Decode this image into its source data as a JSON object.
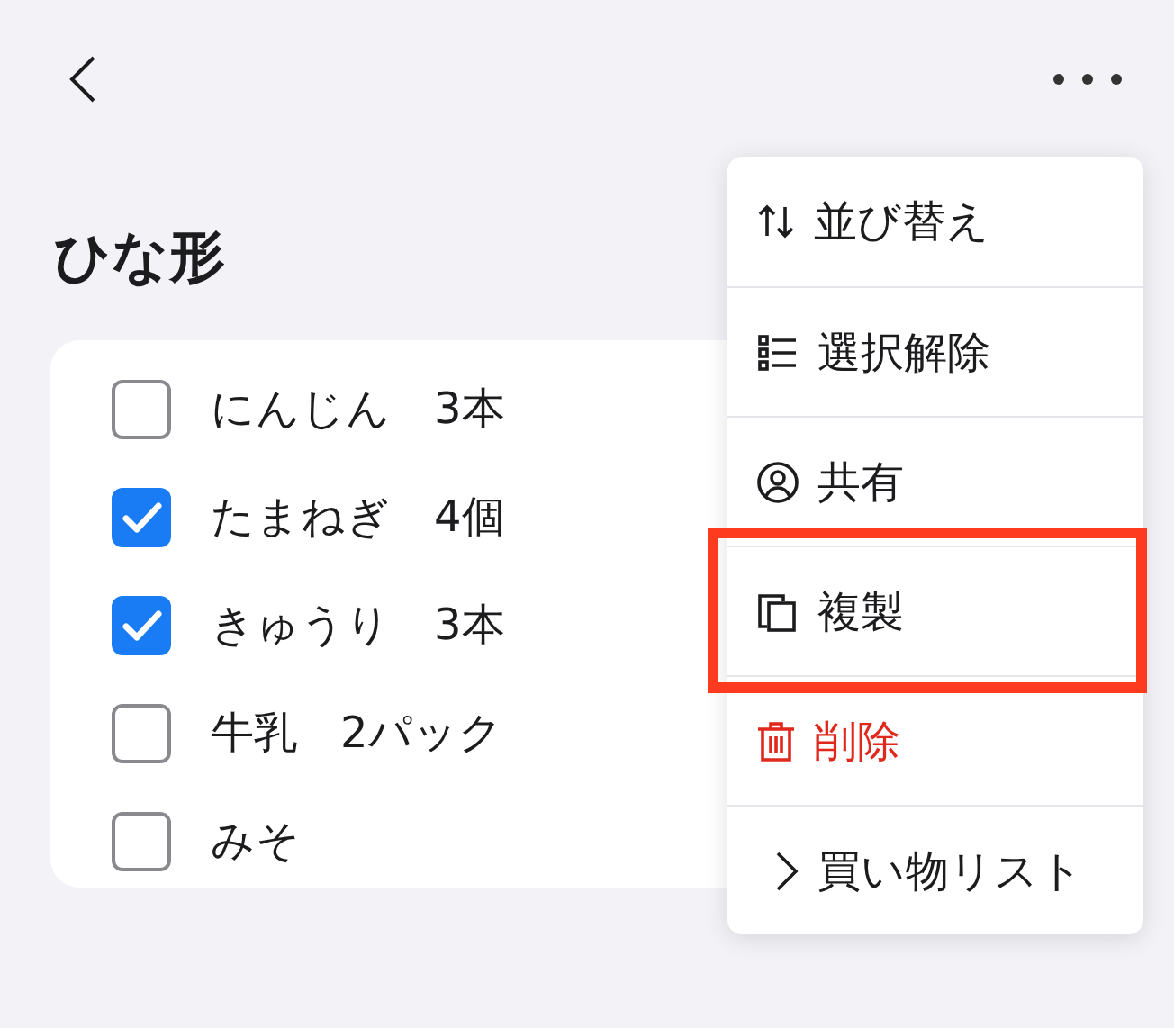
{
  "title": "ひな形",
  "items": [
    {
      "label": "にんじん　3本",
      "checked": false
    },
    {
      "label": "たまねぎ　4個",
      "checked": true
    },
    {
      "label": "きゅうり　3本",
      "checked": true
    },
    {
      "label": "牛乳　2パック",
      "checked": false
    },
    {
      "label": "みそ",
      "checked": false
    }
  ],
  "menu": [
    {
      "kind": "sort",
      "label": "並び替え",
      "destructive": false,
      "highlighted": false
    },
    {
      "kind": "list",
      "label": "選択解除",
      "destructive": false,
      "highlighted": false
    },
    {
      "kind": "share",
      "label": "共有",
      "destructive": false,
      "highlighted": false
    },
    {
      "kind": "copy",
      "label": "複製",
      "destructive": false,
      "highlighted": true
    },
    {
      "kind": "delete",
      "label": "削除",
      "destructive": true,
      "highlighted": false
    },
    {
      "kind": "submenu",
      "label": "買い物リスト",
      "destructive": false,
      "highlighted": false
    }
  ]
}
